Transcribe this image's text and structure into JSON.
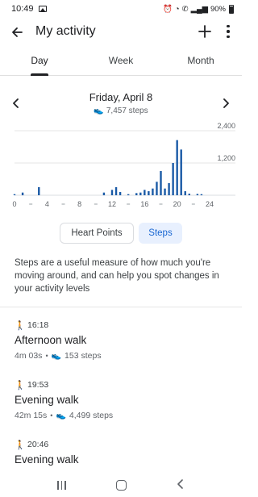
{
  "status_bar": {
    "time": "10:49",
    "battery": "90%"
  },
  "app_bar": {
    "title": "My activity"
  },
  "tabs": [
    {
      "label": "Day",
      "active": true
    },
    {
      "label": "Week",
      "active": false
    },
    {
      "label": "Month",
      "active": false
    }
  ],
  "date_nav": {
    "date": "Friday, April 8",
    "steps_summary": "7,457 steps"
  },
  "chart_data": {
    "type": "bar",
    "x": [
      0,
      1,
      3,
      11,
      12,
      12.5,
      13,
      14,
      15,
      15.5,
      16,
      16.5,
      17,
      17.5,
      18,
      18.5,
      19,
      19.5,
      20,
      20.5,
      21,
      21.5,
      22.5,
      23
    ],
    "values": [
      40,
      100,
      300,
      100,
      200,
      300,
      120,
      40,
      80,
      100,
      200,
      150,
      250,
      500,
      900,
      250,
      450,
      1200,
      2050,
      1700,
      150,
      60,
      50,
      40
    ],
    "xlim": [
      0,
      24
    ],
    "ylim": [
      0,
      2400
    ],
    "x_ticks": [
      "0",
      "4",
      "8",
      "12",
      "16",
      "20",
      "24"
    ],
    "y_ticks": [
      "1,200",
      "2,400"
    ],
    "color": "#1a5aa6"
  },
  "metric_toggle": {
    "heart_points": "Heart Points",
    "steps": "Steps"
  },
  "description": "Steps are a useful measure of how much you're moving around, and can help you spot changes in your activity levels",
  "sessions": [
    {
      "time": "16:18",
      "title": "Afternoon walk",
      "duration": "4m 03s",
      "steps": "153 steps"
    },
    {
      "time": "19:53",
      "title": "Evening walk",
      "duration": "42m 15s",
      "steps": "4,499 steps"
    },
    {
      "time": "20:46",
      "title": "Evening walk"
    }
  ],
  "colors": {
    "accent": "#1a73e8",
    "chip_bg": "#e8f0fe",
    "bar": "#1a5aa6"
  }
}
